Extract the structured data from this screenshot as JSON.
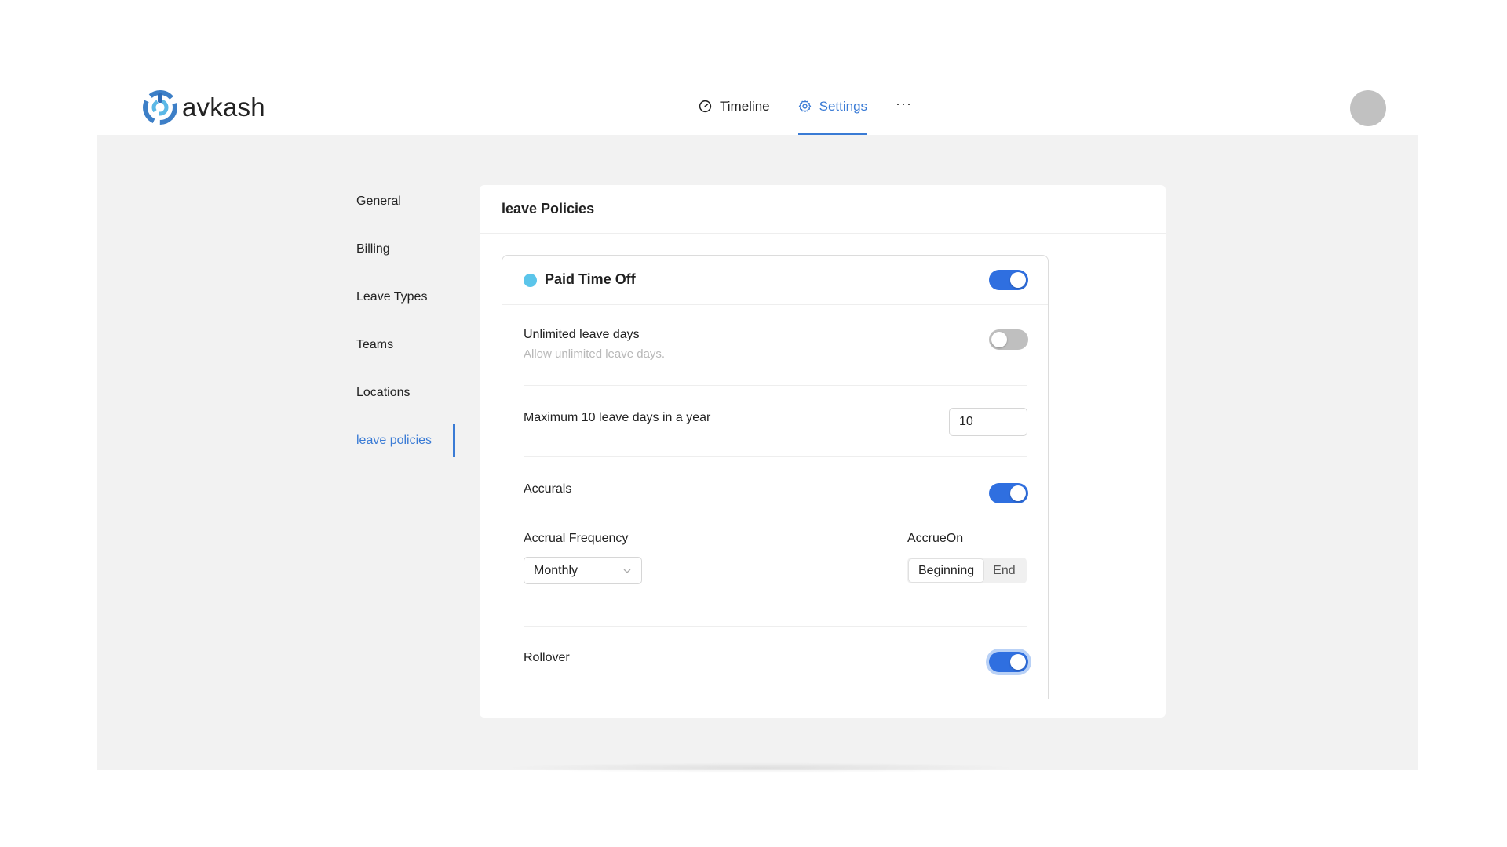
{
  "app": {
    "name": "avkash"
  },
  "nav": {
    "items": [
      {
        "label": "Timeline",
        "icon": "gauge-icon",
        "active": false
      },
      {
        "label": "Settings",
        "icon": "gear-icon",
        "active": true
      }
    ],
    "more_label": "···"
  },
  "sidebar": {
    "items": [
      {
        "label": "General"
      },
      {
        "label": "Billing"
      },
      {
        "label": "Leave Types"
      },
      {
        "label": "Teams"
      },
      {
        "label": "Locations"
      },
      {
        "label": "leave policies",
        "active": true
      }
    ]
  },
  "panel": {
    "title": "leave Policies",
    "policy": {
      "name": "Paid Time Off",
      "color": "#5bc5ea",
      "enabled": true,
      "unlimited": {
        "label": "Unlimited leave days",
        "description": "Allow unlimited leave days.",
        "enabled": false
      },
      "maximum": {
        "label": "Maximum 10 leave days in a year",
        "value": "10"
      },
      "accruals": {
        "label": "Accurals",
        "enabled": true,
        "frequency_label": "Accrual Frequency",
        "frequency_value": "Monthly",
        "accrue_on_label": "AccrueOn",
        "accrue_on_options": [
          "Beginning",
          "End"
        ],
        "accrue_on_selected": "Beginning"
      },
      "rollover": {
        "label": "Rollover",
        "enabled": true
      }
    }
  },
  "colors": {
    "accent": "#3a7bd5",
    "toggle_on": "#2f6fe0",
    "toggle_off": "#bfbfbf",
    "content_bg": "#f2f2f2"
  }
}
